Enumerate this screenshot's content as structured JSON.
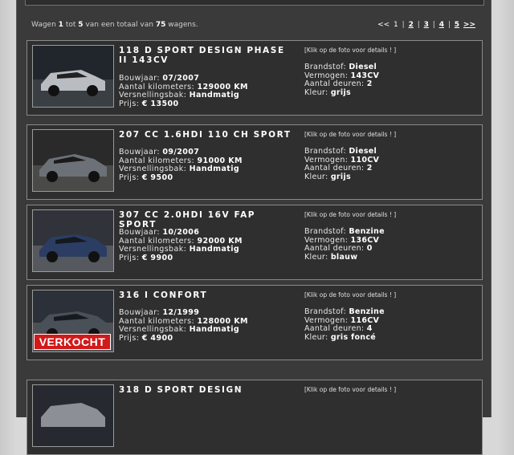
{
  "summary": {
    "pre": "Wagen",
    "from": "1",
    "mid1": "tot",
    "to": "5",
    "mid2": "van een totaal van",
    "total": "75",
    "post": "wagens."
  },
  "pager": {
    "prev": "<<",
    "current": "1",
    "pages": [
      "2",
      "3",
      "4",
      "5"
    ],
    "next": ">>",
    "sep": "|"
  },
  "labels": {
    "bouwjaar": "Bouwjaar:",
    "km": "Aantal kilometers:",
    "gear": "Versnellingsbak:",
    "price": "Prijs:",
    "fuel": "Brandstof:",
    "power": "Vermogen:",
    "doors": "Aantal deuren:",
    "color": "Kleur:",
    "hint": "[Klik op de foto voor details ! ]",
    "sold": "VERKOCHT"
  },
  "cars": [
    {
      "title": "118 D SPORT DESIGN PHASE II 143CV",
      "year": "07/2007",
      "km": "129000 KM",
      "gear": "Handmatig",
      "price": "€ 13500",
      "fuel": "Diesel",
      "power": "143CV",
      "doors": "2",
      "color": "grijs",
      "photo_color": "#b9bdc2"
    },
    {
      "title": "207 CC 1.6HDI 110 CH SPORT",
      "year": "09/2007",
      "km": "91000 KM",
      "gear": "Handmatig",
      "price": "€ 9500",
      "fuel": "Diesel",
      "power": "110CV",
      "doors": "2",
      "color": "grijs",
      "photo_color": "#6c7177"
    },
    {
      "title": "307 CC 2.0HDI 16V FAP SPORT",
      "year": "10/2006",
      "km": "92000 KM",
      "gear": "Handmatig",
      "price": "€ 9900",
      "fuel": "Benzine",
      "power": "136CV",
      "doors": "0",
      "color": "blauw",
      "photo_color": "#2c3d63"
    },
    {
      "title": "316 I CONFORT",
      "year": "12/1999",
      "km": "128000 KM",
      "gear": "Handmatig",
      "price": "€ 4900",
      "fuel": "Benzine",
      "power": "116CV",
      "doors": "4",
      "color": "gris foncé",
      "photo_color": "#4a5058",
      "sold": true
    },
    {
      "title": "318 D SPORT DESIGN",
      "photo_color": "#8c9096"
    }
  ]
}
